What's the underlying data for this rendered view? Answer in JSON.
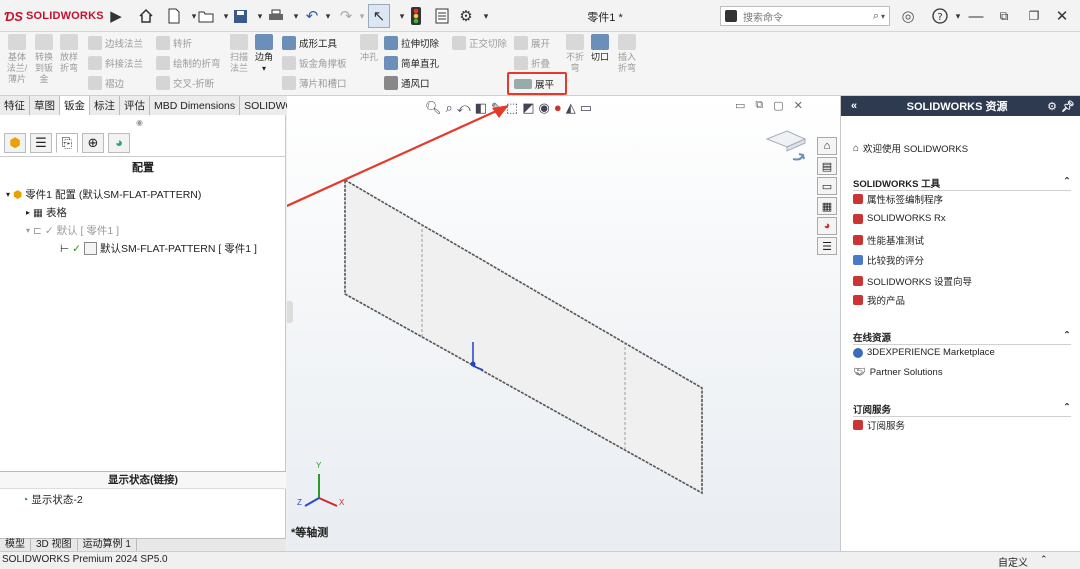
{
  "app": {
    "brand": "SOLIDWORKS",
    "doc_title": "零件1 *",
    "search_placeholder": "搜索命令",
    "version": "SOLIDWORKS Premium 2024 SP5.0"
  },
  "ribbon": {
    "big": [
      {
        "label": "基体\n法兰/\n薄片",
        "enabled": false
      },
      {
        "label": "转换\n到钣\n金",
        "enabled": false
      },
      {
        "label": "放样\n折弯",
        "enabled": false
      }
    ],
    "col1": [
      {
        "label": "边线法兰",
        "enabled": false
      },
      {
        "label": "斜接法兰",
        "enabled": false
      },
      {
        "label": "褶边",
        "enabled": false
      }
    ],
    "col2": [
      {
        "label": "转折",
        "enabled": false
      },
      {
        "label": "绘制的折弯",
        "enabled": false
      },
      {
        "label": "交叉-折断",
        "enabled": false
      }
    ],
    "scan": {
      "label": "扫描\n法兰",
      "enabled": false
    },
    "corner": {
      "label": "边角",
      "enabled": true
    },
    "col3": [
      {
        "label": "成形工具",
        "enabled": true
      },
      {
        "label": "钣金角撑板",
        "enabled": false
      },
      {
        "label": "薄片和槽口",
        "enabled": false
      }
    ],
    "stamp": {
      "label": "冲孔",
      "enabled": false
    },
    "col4": [
      {
        "label": "拉伸切除",
        "enabled": true
      },
      {
        "label": "简单直孔",
        "enabled": true
      },
      {
        "label": "通风口",
        "enabled": true
      }
    ],
    "col5": [
      {
        "label": "正交切除",
        "enabled": false
      }
    ],
    "unfold": {
      "label": "展开",
      "enabled": false
    },
    "fold": {
      "label": "折叠",
      "enabled": false
    },
    "nofold": {
      "label": "不折\n弯",
      "enabled": false
    },
    "flatten": {
      "label": "展平",
      "enabled": true
    },
    "rip": {
      "label": "切口",
      "enabled": true
    },
    "insertbend": {
      "label": "插入\n折弯",
      "enabled": false
    }
  },
  "cmd_tabs": [
    "特征",
    "草图",
    "钣金",
    "标注",
    "评估",
    "MBD Dimensions",
    "SOLIDWORKS 插件"
  ],
  "cmd_tab_active": 2,
  "left": {
    "header": "配置",
    "tree": [
      {
        "text": "零件1 配置  (默认SM-FLAT-PATTERN)",
        "grey": false
      },
      {
        "text": "表格",
        "grey": false
      },
      {
        "text": "默认 [ 零件1 ]",
        "grey": true
      },
      {
        "text": "默认SM-FLAT-PATTERN [ 零件1 ]",
        "grey": false
      }
    ],
    "display_header": "显示状态(链接)",
    "display_item": "显示状态-2",
    "bottom_tabs": [
      "模型",
      "3D 视图",
      "运动算例 1"
    ]
  },
  "viewport": {
    "view_label": "*等轴测",
    "axis_x": "X",
    "axis_y": "Y",
    "axis_z": "Z"
  },
  "right": {
    "title": "SOLIDWORKS 资源",
    "welcome": "欢迎使用  SOLIDWORKS",
    "sec_tools": "SOLIDWORKS 工具",
    "tools": [
      "属性标签编制程序",
      "SOLIDWORKS Rx",
      "性能基准测试",
      "比较我的评分",
      "SOLIDWORKS 设置向导",
      "我的产品"
    ],
    "sec_online": "在线资源",
    "online": [
      "3DEXPERIENCE Marketplace",
      "Partner Solutions"
    ],
    "sec_sub": "订阅服务",
    "sub": [
      "订阅服务"
    ]
  },
  "status": {
    "custom": "自定义"
  },
  "colors": {
    "accent": "#e53a2a",
    "header_bg": "#2d3a4f",
    "brand_red": "#c8102e"
  }
}
